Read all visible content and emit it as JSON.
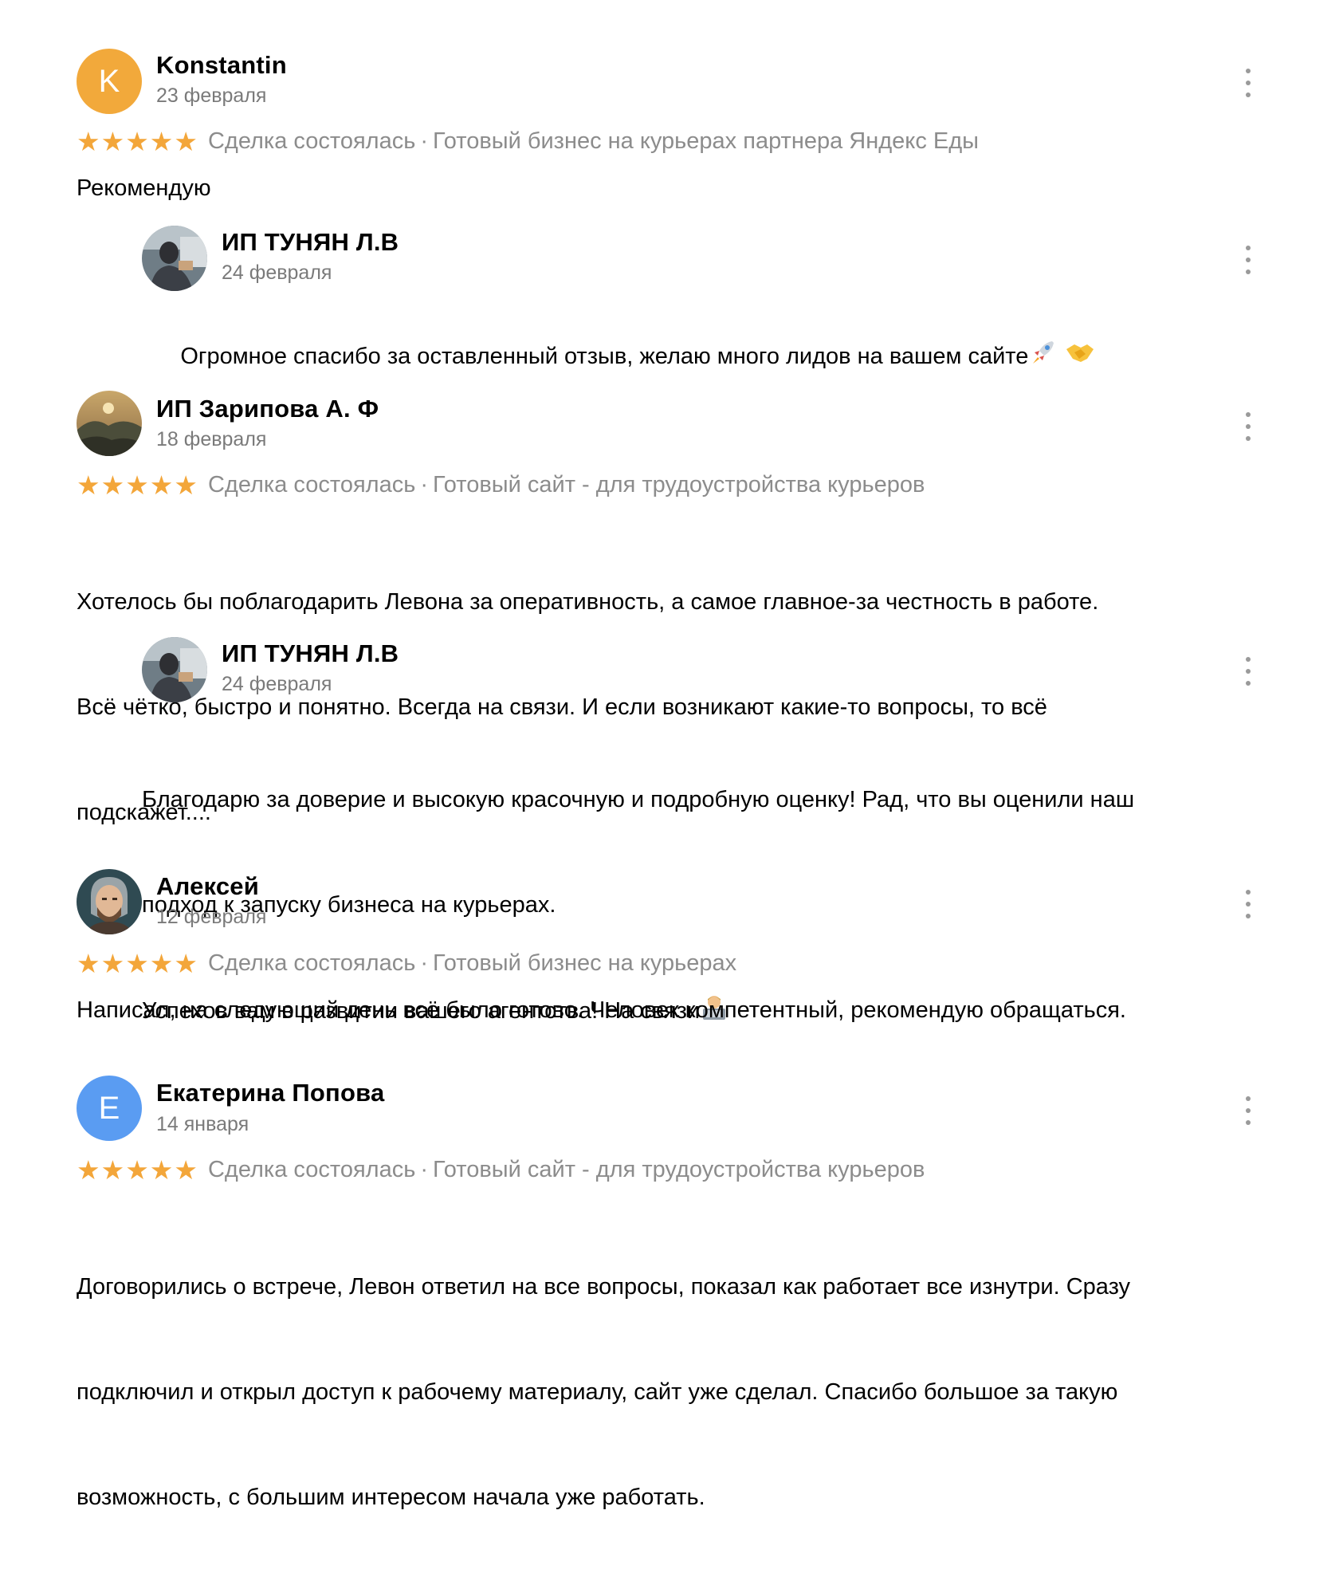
{
  "reviews": [
    {
      "author": "Konstantin",
      "initial": "K",
      "avatar_color": "#f2a93b",
      "date": "23 февраля",
      "rating": 5,
      "status": "Сделка состоялась",
      "separator": "·",
      "listing": "Готовый бизнес на курьерах партнера Яндекс Еды",
      "text": "Рекомендую",
      "reply": {
        "author": "ИП ТУНЯН Л.В",
        "date": "24 февраля",
        "text": "Огромное спасибо за оставленный отзыв, желаю много лидов на вашем сайте",
        "emoji": [
          "rocket-emoji",
          "handshake-emoji"
        ]
      }
    },
    {
      "author": "ИП Зарипова А. Ф",
      "date": "18 февраля",
      "rating": 5,
      "status": "Сделка состоялась",
      "separator": "·",
      "listing": "Готовый сайт - для трудоустройства курьеров",
      "text": "Хотелось бы поблагодарить Левона за оперативность, а самое главное-за честность в работе. Всё чётко, быстро и понятно. Всегда на связи. И если возникают какие-то вопросы, то всё подскажет....",
      "text_lines": [
        "Хотелось бы поблагодарить Левона за оперативность, а самое главное-за честность в работе.",
        "Всё чётко, быстро и понятно. Всегда на связи. И если возникают какие-то вопросы, то всё",
        "подскажет...."
      ],
      "reply": {
        "author": "ИП ТУНЯН Л.В",
        "date": "24 февраля",
        "text_lines": [
          "Благодарю за доверие и высокую красочную и подробную оценку! Рад, что вы оценили наш",
          "подход к запуску бизнеса на курьерах.",
          "Успехов вам в развитии вашего агентства! На связи"
        ],
        "emoji": [
          "technologist-emoji"
        ]
      }
    },
    {
      "author": "Алексей",
      "date": "12 февраля",
      "rating": 5,
      "status": "Сделка состоялась",
      "separator": "·",
      "listing": "Готовый бизнес на курьерах",
      "text": "Написал, на следующий день всё было готово. Человек компетентный, рекомендую обращаться."
    },
    {
      "author": "Екатерина Попова",
      "initial": "Е",
      "avatar_color": "#5a9cf2",
      "date": "14 января",
      "rating": 5,
      "status": "Сделка состоялась",
      "separator": "·",
      "listing": "Готовый сайт - для трудоустройства курьеров",
      "text_lines": [
        "Договорились о встрече, Левон ответил на все вопросы, показал как работает все изнутри. Сразу",
        "подключил и открыл доступ к рабочему материалу, сайт уже сделал. Спасибо большое за такую",
        "возможность, с большим интересом начала уже работать."
      ]
    }
  ],
  "colors": {
    "star": "#f3a63a",
    "meta_text": "#8c8c8c",
    "date_text": "#7a7a7a",
    "menu_dot": "#9a9a9a"
  },
  "icons": [
    "star-icon",
    "more-vertical-icon"
  ]
}
